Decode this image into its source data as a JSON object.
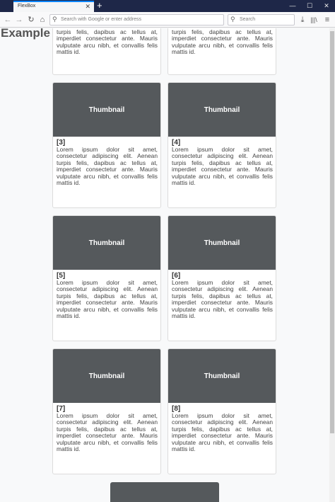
{
  "browser": {
    "tab_title": "FlexBox",
    "tab_close": "✕",
    "new_tab": "+",
    "url_placeholder": "Search with Google or enter address",
    "search_placeholder": "Search",
    "win_minimize": "—",
    "win_maximize": "☐",
    "win_close": "✕"
  },
  "page": {
    "title": "Example Page"
  },
  "cards": [
    {
      "num": "",
      "thumb": "",
      "body": "turpis felis, dapibus ac tellus at, imperdiet consectetur ante. Mauris vulputate arcu nibh, et convallis felis mattis id."
    },
    {
      "num": "",
      "thumb": "",
      "body": "turpis felis, dapibus ac tellus at, imperdiet consectetur ante. Mauris vulputate arcu nibh, et convallis felis mattis id."
    },
    {
      "num": "[3]",
      "thumb": "Thumbnail",
      "body": "Lorem ipsum dolor sit amet, consectetur adipiscing elit. Aenean turpis felis, dapibus ac tellus at, imperdiet consectetur ante. Mauris vulputate arcu nibh, et convallis felis mattis id."
    },
    {
      "num": "[4]",
      "thumb": "Thumbnail",
      "body": "Lorem ipsum dolor sit amet, consectetur adipiscing elit. Aenean turpis felis, dapibus ac tellus at, imperdiet consectetur ante. Mauris vulputate arcu nibh, et convallis felis mattis id."
    },
    {
      "num": "[5]",
      "thumb": "Thumbnail",
      "body": "Lorem ipsum dolor sit amet, consectetur adipiscing elit. Aenean turpis felis, dapibus ac tellus at, imperdiet consectetur ante. Mauris vulputate arcu nibh, et convallis felis mattis id."
    },
    {
      "num": "[6]",
      "thumb": "Thumbnail",
      "body": "Lorem ipsum dolor sit amet, consectetur adipiscing elit. Aenean turpis felis, dapibus ac tellus at, imperdiet consectetur ante. Mauris vulputate arcu nibh, et convallis felis mattis id."
    },
    {
      "num": "[7]",
      "thumb": "Thumbnail",
      "body": "Lorem ipsum dolor sit amet, consectetur adipiscing elit. Aenean turpis felis, dapibus ac tellus at, imperdiet consectetur ante. Mauris vulputate arcu nibh, et convallis felis mattis id."
    },
    {
      "num": "[8]",
      "thumb": "Thumbnail",
      "body": "Lorem ipsum dolor sit amet, consectetur adipiscing elit. Aenean turpis felis, dapibus ac tellus at, imperdiet consectetur ante. Mauris vulputate arcu nibh, et convallis felis mattis id."
    }
  ]
}
